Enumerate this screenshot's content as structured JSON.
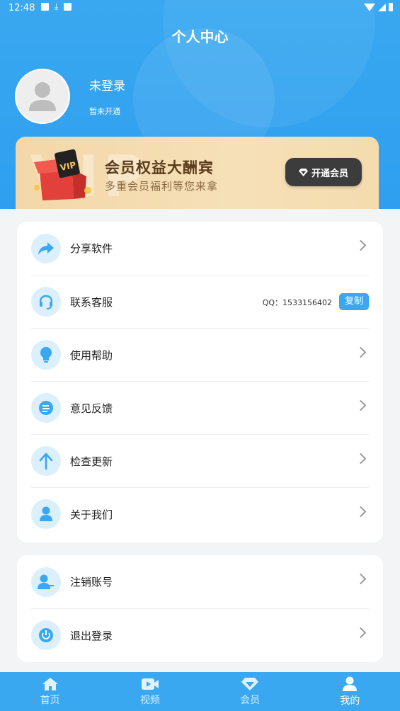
{
  "status_bar": {
    "time": "12:48"
  },
  "header": {
    "title": "个人中心"
  },
  "user": {
    "name": "未登录",
    "member_status": "暂未开通"
  },
  "vip_banner": {
    "badge": "VIP",
    "title": "会员权益大酬宾",
    "subtitle": "多重会员福利等您来拿",
    "button_label": "开通会员"
  },
  "menu": {
    "share": "分享软件",
    "support": "联系客服",
    "support_qq": "QQ：1533156402",
    "copy_label": "复制",
    "help": "使用帮助",
    "feedback": "意见反馈",
    "update": "检查更新",
    "about": "关于我们"
  },
  "account": {
    "deregister": "注销账号",
    "logout": "退出登录"
  },
  "tabbar": {
    "home": "首页",
    "video": "视频",
    "vip": "会员",
    "mine": "我的"
  },
  "colors": {
    "primary": "#3aa8f0",
    "icon_bg": "#dbeffd",
    "vip_gold": "#f3d7a8",
    "vip_btn": "#3c3c3c"
  }
}
